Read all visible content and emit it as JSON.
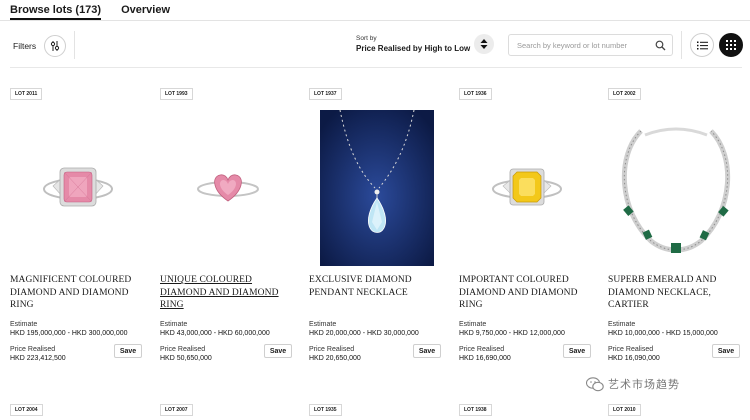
{
  "tabs": [
    {
      "label": "Browse lots (173)",
      "active": true
    },
    {
      "label": "Overview",
      "active": false
    }
  ],
  "toolbar": {
    "filters_label": "Filters",
    "filters_icon": "sliders-icon",
    "sort_label": "Sort by",
    "sort_value": "Price Realised by High to Low",
    "sort_icon": "sort-arrows-icon",
    "search_placeholder": "Search by keyword or lot number",
    "search_icon": "search-icon",
    "list_view_icon": "list-view-icon",
    "grid_view_icon": "grid-view-icon"
  },
  "lots": [
    {
      "lot_number": "LOT 2011",
      "title": "MAGNIFICENT COLOURED DIAMOND AND DIAMOND RING",
      "estimate_label": "Estimate",
      "estimate": "HKD 195,000,000 - HKD 300,000,000",
      "price_label": "Price Realised",
      "price": "HKD 223,412,500",
      "save_label": "Save",
      "image": "pink-diamond-ring",
      "underlined": false
    },
    {
      "lot_number": "LOT 1993",
      "title": "UNIQUE COLOURED DIAMOND AND DIAMOND RING",
      "estimate_label": "Estimate",
      "estimate": "HKD 43,000,000 - HKD 60,000,000",
      "price_label": "Price Realised",
      "price": "HKD 50,650,000",
      "save_label": "Save",
      "image": "heart-pink-diamond-ring",
      "underlined": true
    },
    {
      "lot_number": "LOT 1937",
      "title": "EXCLUSIVE DIAMOND PENDANT NECKLACE",
      "estimate_label": "Estimate",
      "estimate": "HKD 20,000,000 - HKD 30,000,000",
      "price_label": "Price Realised",
      "price": "HKD 20,650,000",
      "save_label": "Save",
      "image": "diamond-pendant-necklace",
      "underlined": false
    },
    {
      "lot_number": "LOT 1936",
      "title": "IMPORTANT COLOURED DIAMOND AND DIAMOND RING",
      "estimate_label": "Estimate",
      "estimate": "HKD 9,750,000 - HKD 12,000,000",
      "price_label": "Price Realised",
      "price": "HKD 16,690,000",
      "save_label": "Save",
      "image": "yellow-diamond-ring",
      "underlined": false
    },
    {
      "lot_number": "LOT 2002",
      "title": "SUPERB EMERALD AND DIAMOND NECKLACE, CARTIER",
      "estimate_label": "Estimate",
      "estimate": "HKD 10,000,000 - HKD 15,000,000",
      "price_label": "Price Realised",
      "price": "HKD 16,090,000",
      "save_label": "Save",
      "image": "emerald-diamond-necklace",
      "underlined": false
    }
  ],
  "next_row_lots": [
    "LOT 2004",
    "LOT 2007",
    "LOT 1935",
    "LOT 1938",
    "LOT 2010"
  ],
  "watermark": {
    "text": "艺术市场趋势",
    "icon": "wechat-icon"
  },
  "colors": {
    "pink_stone": "#e58aa8",
    "yellow_stone": "#f3c81a",
    "emerald": "#1f6b45",
    "pendant_bg": "#14285f",
    "accent": "#111111"
  }
}
